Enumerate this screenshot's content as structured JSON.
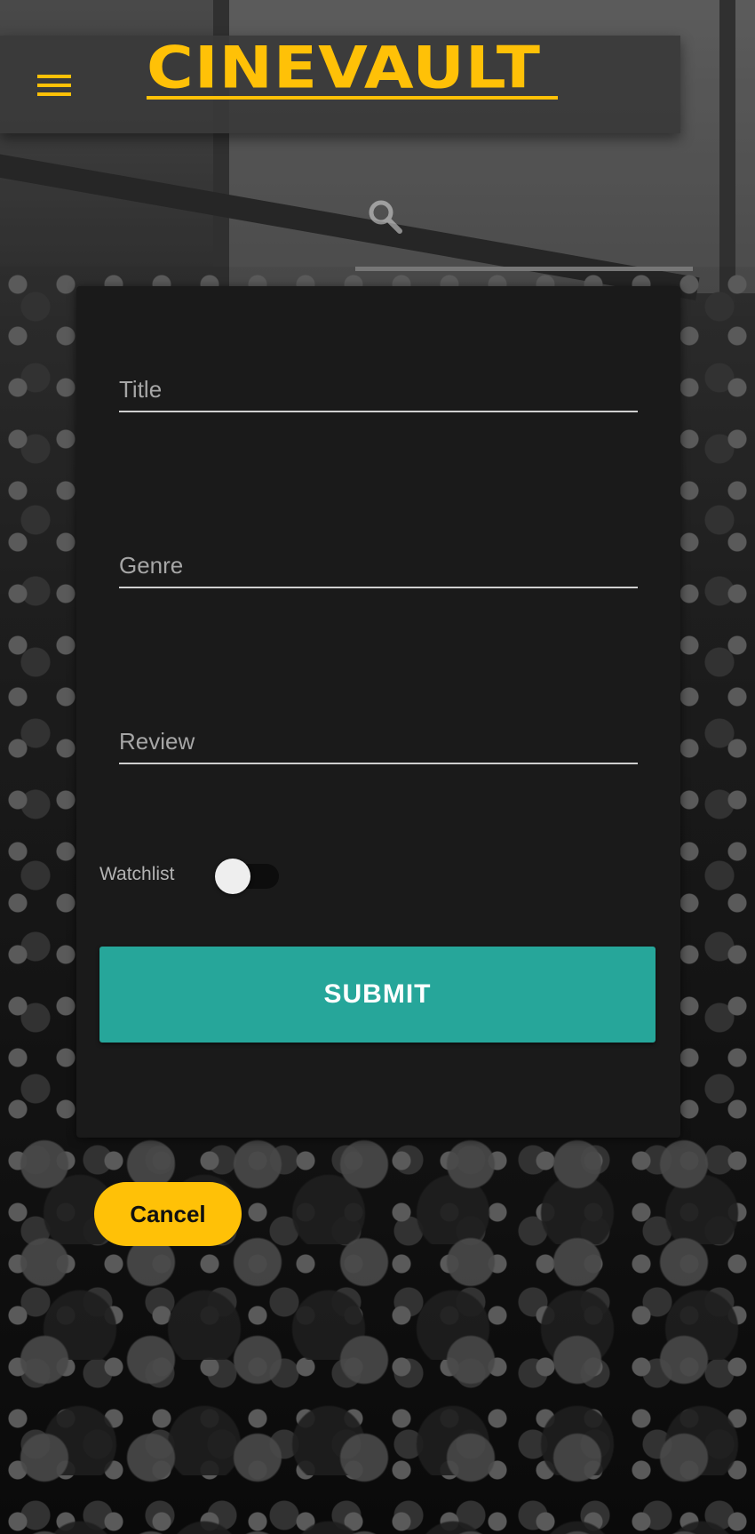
{
  "header": {
    "brand": "CINEVAULT",
    "menu_icon": "hamburger-menu-icon",
    "search_icon": "search-icon"
  },
  "form": {
    "fields": [
      {
        "placeholder": "Title",
        "value": ""
      },
      {
        "placeholder": "Genre",
        "value": ""
      },
      {
        "placeholder": "Review",
        "value": ""
      }
    ],
    "watchlist_label": "Watchlist",
    "watchlist_on": false,
    "submit_label": "SUBMIT"
  },
  "actions": {
    "cancel_label": "Cancel"
  },
  "colors": {
    "accent": "#ffc107",
    "submit": "#26a69a",
    "card": "#1a1a1a"
  }
}
